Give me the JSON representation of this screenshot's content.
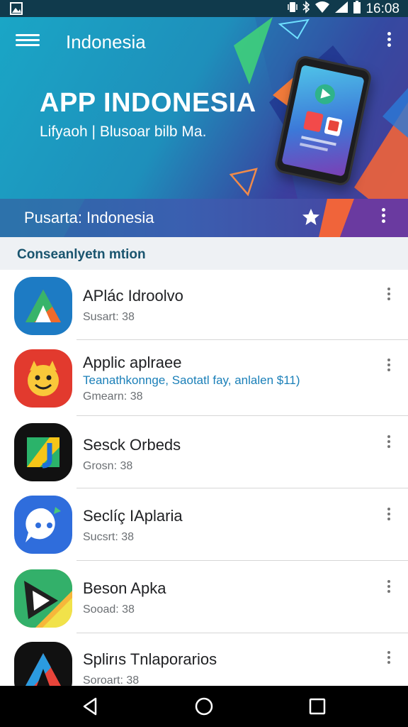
{
  "status_bar": {
    "time": "16:08"
  },
  "app_bar": {
    "title": "Indonesia"
  },
  "hero": {
    "title": "APP INDONESIA",
    "subtitle": "Lifyaoh | Blusoar bilb Ma."
  },
  "section_bar": {
    "label": "Pusarta: Indonesia"
  },
  "sub_header": {
    "text": "Consеanlyetn mtion"
  },
  "apps": [
    {
      "name": "APlác Idroolvo",
      "description": "",
      "meta": "Susart: 38",
      "icon": "triangle-a-icon"
    },
    {
      "name": "Applic aplraee",
      "description": "Teanathkonnge, Saotatl fay, anlalen $11)",
      "meta": "Gmearn: 38",
      "icon": "smiley-face-icon"
    },
    {
      "name": "Sesck Orbeds",
      "description": "",
      "meta": "Grosn: 38",
      "icon": "square-j-icon"
    },
    {
      "name": "Seclíç IAplaria",
      "description": "",
      "meta": "Sucsrt: 38",
      "icon": "chat-bubble-icon"
    },
    {
      "name": "Beson Apka",
      "description": "",
      "meta": "Sooad: 38",
      "icon": "play-triangle-icon"
    },
    {
      "name": "Splirıs Tnlaporarios",
      "description": "",
      "meta": "Soroart: 38",
      "icon": "a-logo-icon"
    }
  ],
  "colors": {
    "status_bar": "#103a4c",
    "accent": "#1aa6c6",
    "section_bar": "#2d6aa8",
    "sub_header_text": "#19546e",
    "description_text": "#1a7fb8"
  }
}
